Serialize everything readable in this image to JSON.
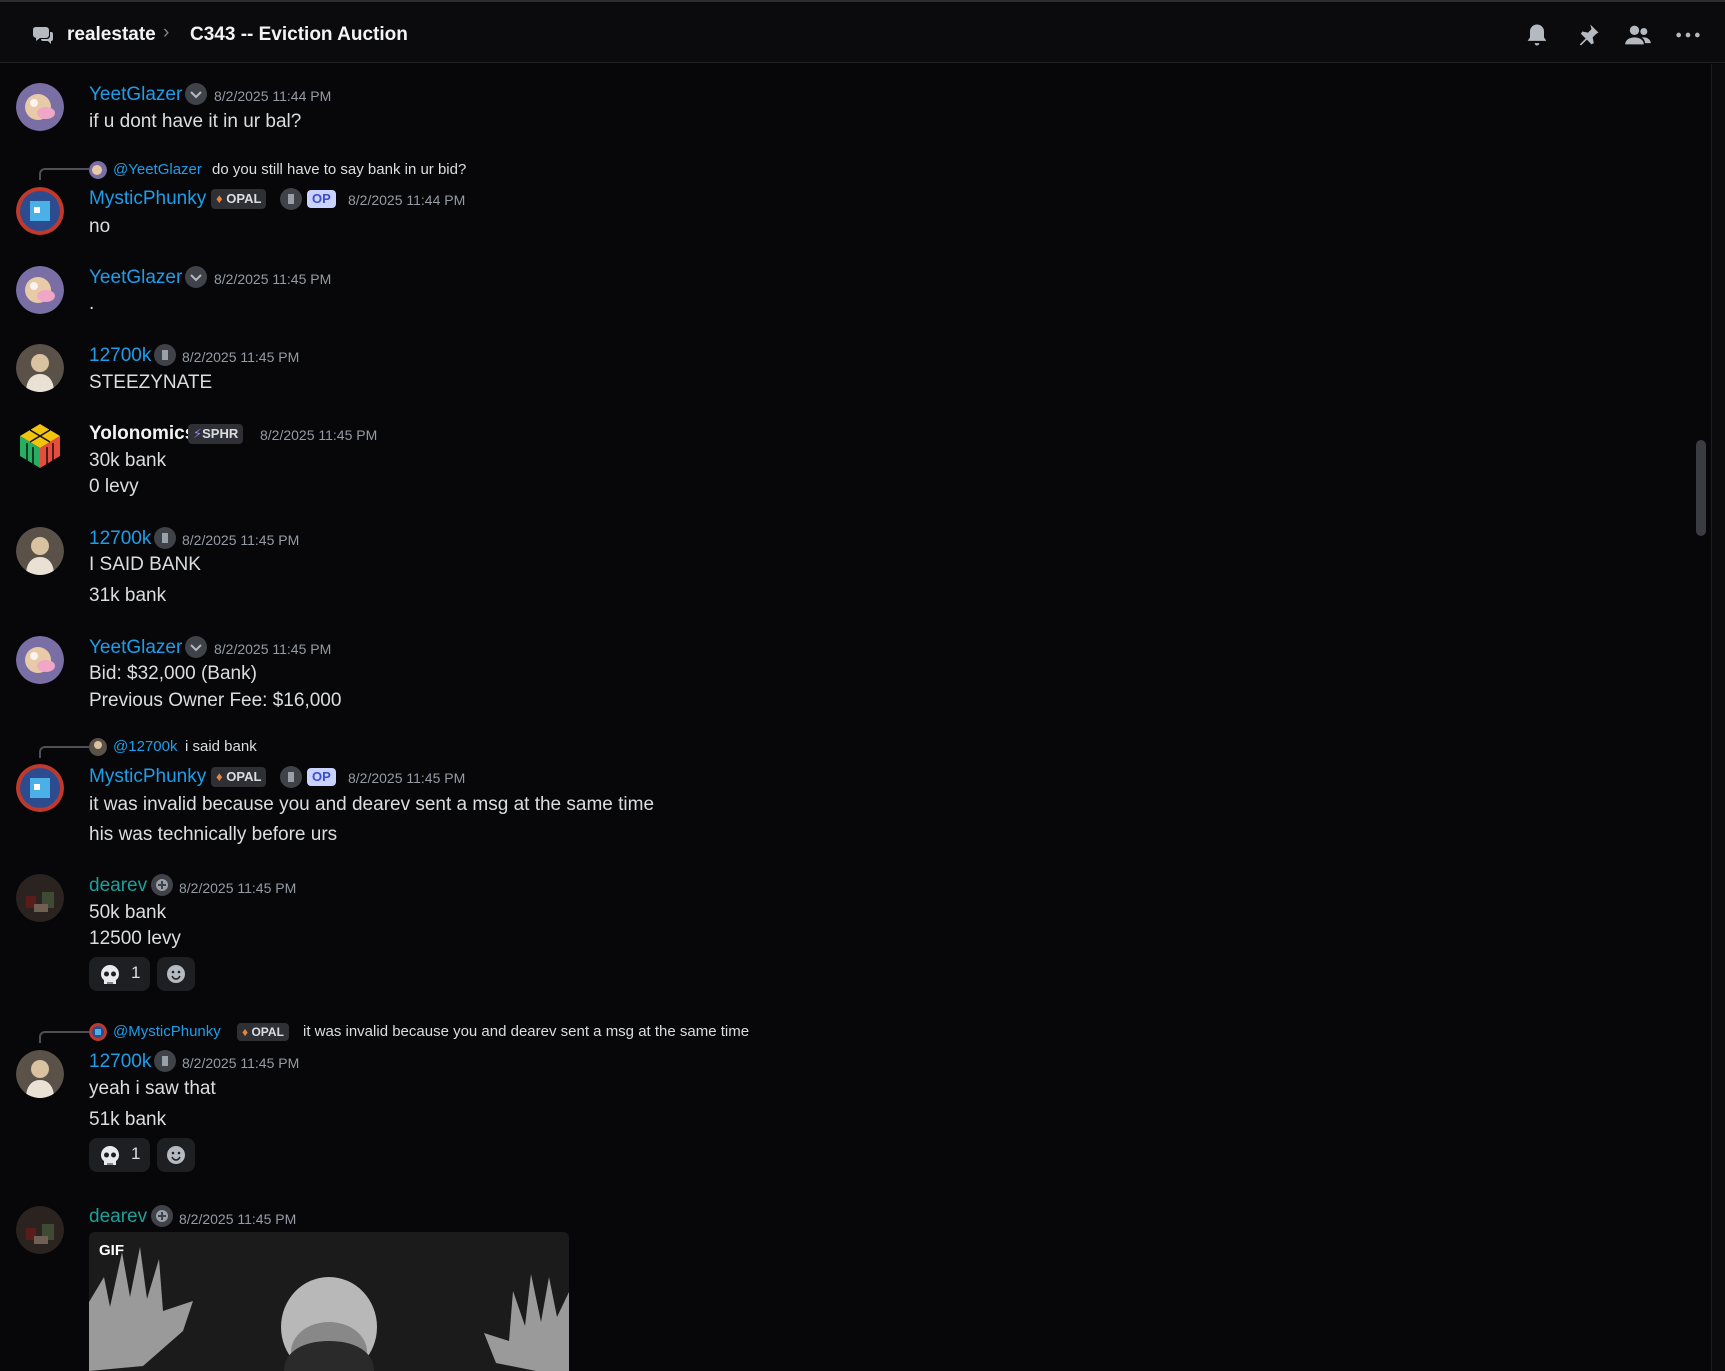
{
  "header": {
    "server": "realestate",
    "separator": "›",
    "channel": "C343 -- Eviction Auction"
  },
  "messages": [
    {
      "author": "YeetGlazer",
      "time": "8/2/2025 11:44 PM",
      "lines": [
        "if u dont have it in ur bal?"
      ]
    },
    {
      "reply": {
        "name": "@YeetGlazer",
        "text": "do you still have to say bank in ur bid?"
      },
      "author": "MysticPhunky",
      "tag": "OPAL",
      "op": "OP",
      "time": "8/2/2025 11:44 PM",
      "lines": [
        "no"
      ]
    },
    {
      "author": "YeetGlazer",
      "time": "8/2/2025 11:45 PM",
      "lines": [
        "."
      ]
    },
    {
      "author": "12700k",
      "time": "8/2/2025 11:45 PM",
      "lines": [
        "STEEZYNATE"
      ]
    },
    {
      "author": "Yolonomics",
      "tag": "SPHR",
      "time": "8/2/2025 11:45 PM",
      "lines": [
        "30k bank",
        "0 levy"
      ]
    },
    {
      "author": "12700k",
      "time": "8/2/2025 11:45 PM",
      "lines": [
        "I SAID BANK",
        "31k bank"
      ]
    },
    {
      "author": "YeetGlazer",
      "time": "8/2/2025 11:45 PM",
      "lines": [
        "Bid: $32,000 (Bank)",
        "Previous Owner Fee: $16,000"
      ]
    },
    {
      "reply": {
        "name": "@12700k",
        "text": "i said bank"
      },
      "author": "MysticPhunky",
      "tag": "OPAL",
      "op": "OP",
      "time": "8/2/2025 11:45 PM",
      "lines": [
        "it was invalid because you and dearev sent a msg at the same time",
        "his was technically before urs"
      ]
    },
    {
      "author": "dearev",
      "time": "8/2/2025 11:45 PM",
      "lines": [
        "50k bank",
        "12500 levy"
      ],
      "reaction": {
        "emoji": "skull",
        "count": "1"
      }
    },
    {
      "reply": {
        "name": "@MysticPhunky",
        "tag": "OPAL",
        "text": "it was invalid because you and dearev sent a msg at the same time"
      },
      "author": "12700k",
      "time": "8/2/2025 11:45 PM",
      "lines": [
        "yeah i saw that",
        "51k bank"
      ],
      "reaction": {
        "emoji": "skull",
        "count": "1"
      }
    },
    {
      "author": "dearev",
      "time": "8/2/2025 11:45 PM",
      "gif_label": "GIF"
    }
  ],
  "colors": {
    "link_blue": "#1e9eea",
    "teal": "#1aa19c",
    "background": "#070709"
  },
  "icons": [
    "forum-icon",
    "bell-icon",
    "pin-icon",
    "members-icon",
    "more-icon",
    "crown-badge-icon",
    "boost-badge-icon",
    "skull-emoji",
    "add-reaction-icon"
  ]
}
